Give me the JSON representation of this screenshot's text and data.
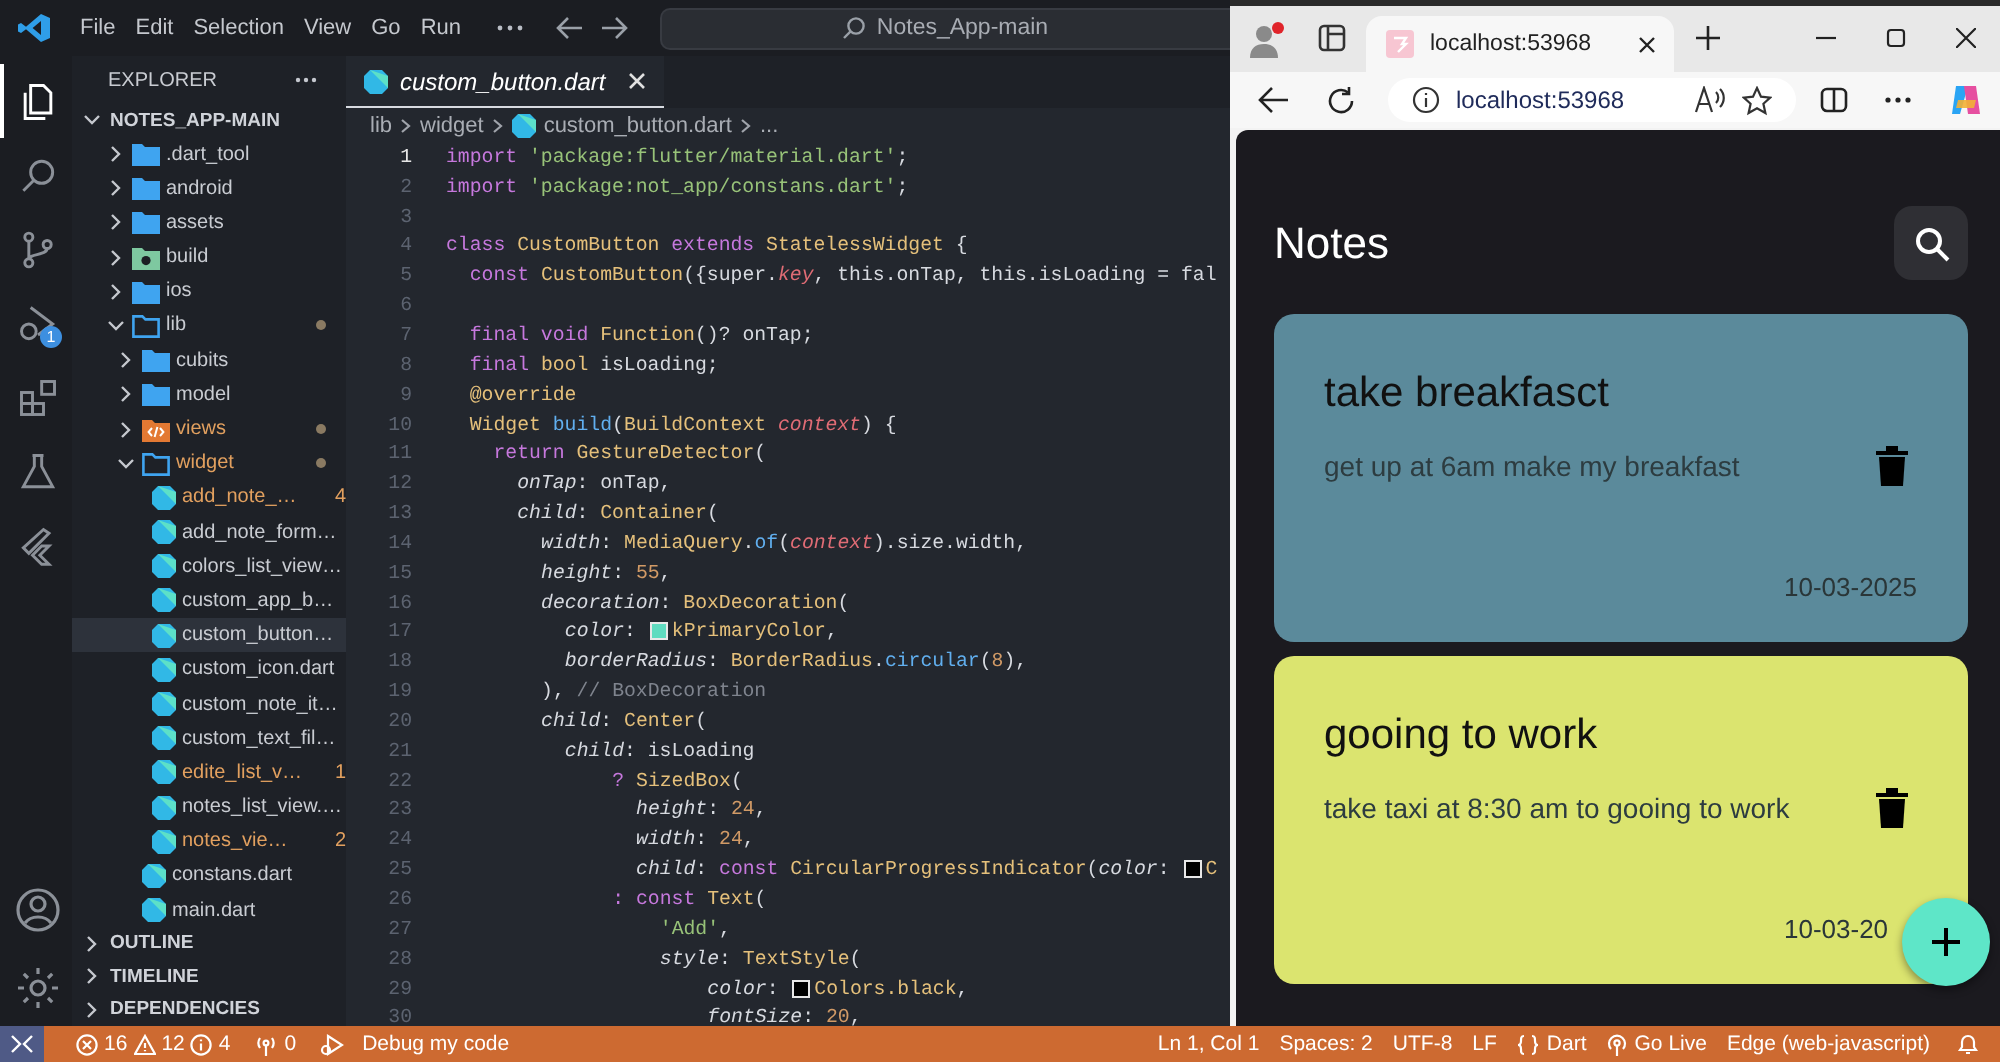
{
  "title_bar": {
    "menu": [
      "File",
      "Edit",
      "Selection",
      "View",
      "Go",
      "Run"
    ],
    "command_center": "Notes_App-main"
  },
  "activity_bar": {
    "items": [
      {
        "kind": "files",
        "selected": true
      },
      {
        "kind": "search",
        "selected": false
      },
      {
        "kind": "source-control",
        "selected": false
      },
      {
        "kind": "debug",
        "selected": false,
        "badge": "1"
      },
      {
        "kind": "extensions",
        "selected": false
      },
      {
        "kind": "testing",
        "selected": false
      },
      {
        "kind": "flutter",
        "selected": false
      }
    ],
    "bottom_items": [
      {
        "kind": "account"
      },
      {
        "kind": "settings"
      }
    ]
  },
  "explorer": {
    "title": "EXPLORER",
    "sections": [
      {
        "label": "NOTES_APP-MAIN",
        "expanded": true,
        "children": [
          {
            "label": ".dart_tool",
            "kind": "folder",
            "expanded": false,
            "selected": false,
            "warning": false,
            "dot": false
          },
          {
            "label": "android",
            "kind": "folder",
            "expanded": false,
            "selected": false,
            "warning": false,
            "dot": false
          },
          {
            "label": "assets",
            "kind": "folder",
            "expanded": false,
            "selected": false,
            "warning": false,
            "dot": false
          },
          {
            "label": "build",
            "kind": "build-folder",
            "expanded": false,
            "selected": false,
            "warning": false,
            "dot": false
          },
          {
            "label": "ios",
            "kind": "folder",
            "expanded": false,
            "selected": false,
            "warning": false,
            "dot": false
          },
          {
            "label": "lib",
            "kind": "folder",
            "expanded": true,
            "selected": false,
            "warning": false,
            "dot": true,
            "children": [
              {
                "label": "cubits",
                "kind": "folder",
                "expanded": false,
                "selected": false,
                "warning": false,
                "dot": false
              },
              {
                "label": "model",
                "kind": "folder",
                "expanded": false,
                "selected": false,
                "warning": false,
                "dot": false
              },
              {
                "label": "views",
                "kind": "views-folder",
                "expanded": false,
                "selected": false,
                "warning": true,
                "dot": true
              },
              {
                "label": "widget",
                "kind": "folder",
                "expanded": true,
                "selected": false,
                "warning": true,
                "dot": true,
                "children": [
                  {
                    "label": "add_note_…",
                    "kind": "dart",
                    "selected": false,
                    "warning": true,
                    "dot": false,
                    "badge": "4"
                  },
                  {
                    "label": "add_note_form…",
                    "kind": "dart",
                    "selected": false,
                    "warning": false,
                    "dot": false
                  },
                  {
                    "label": "colors_list_view…",
                    "kind": "dart",
                    "selected": false,
                    "warning": false,
                    "dot": false
                  },
                  {
                    "label": "custom_app_b…",
                    "kind": "dart",
                    "selected": false,
                    "warning": false,
                    "dot": false
                  },
                  {
                    "label": "custom_button…",
                    "kind": "dart",
                    "selected": true,
                    "warning": false,
                    "dot": false
                  },
                  {
                    "label": "custom_icon.dart",
                    "kind": "dart",
                    "selected": false,
                    "warning": false,
                    "dot": false
                  },
                  {
                    "label": "custom_note_it…",
                    "kind": "dart",
                    "selected": false,
                    "warning": false,
                    "dot": false
                  },
                  {
                    "label": "custom_text_fil…",
                    "kind": "dart",
                    "selected": false,
                    "warning": false,
                    "dot": false
                  },
                  {
                    "label": "edite_list_v…",
                    "kind": "dart",
                    "selected": false,
                    "warning": true,
                    "dot": false,
                    "badge": "1"
                  },
                  {
                    "label": "notes_list_view.…",
                    "kind": "dart",
                    "selected": false,
                    "warning": false,
                    "dot": false
                  },
                  {
                    "label": "notes_vie…",
                    "kind": "dart",
                    "selected": false,
                    "warning": true,
                    "dot": false,
                    "badge": "2"
                  }
                ]
              },
              {
                "label": "constans.dart",
                "kind": "dart",
                "selected": false,
                "warning": false,
                "dot": false
              },
              {
                "label": "main.dart",
                "kind": "dart",
                "selected": false,
                "warning": false,
                "dot": false
              }
            ]
          }
        ]
      },
      {
        "label": "OUTLINE",
        "expanded": false
      },
      {
        "label": "TIMELINE",
        "expanded": false
      },
      {
        "label": "DEPENDENCIES",
        "expanded": false
      }
    ]
  },
  "editor": {
    "tab": {
      "title": "custom_button.dart"
    },
    "breadcrumb": [
      {
        "kind": "folder",
        "text": "lib"
      },
      {
        "kind": "folder",
        "text": "widget"
      },
      {
        "kind": "file",
        "text": "custom_button.dart"
      },
      {
        "kind": "symbol",
        "text": "..."
      }
    ],
    "lines": [
      {
        "number": "1",
        "current": true,
        "tokens": [
          {
            "kind": "kw",
            "text": "import "
          },
          {
            "kind": "str",
            "text": "'package:flutter/material.dart'"
          },
          {
            "kind": "plain",
            "text": ";"
          }
        ]
      },
      {
        "number": "2",
        "current": false,
        "tokens": [
          {
            "kind": "kw",
            "text": "import "
          },
          {
            "kind": "str",
            "text": "'package:not_app/constans.dart'"
          },
          {
            "kind": "plain",
            "text": ";"
          }
        ]
      },
      {
        "number": "3",
        "current": false
      },
      {
        "number": "4",
        "current": false,
        "tokens": [
          {
            "kind": "kw",
            "text": "class "
          },
          {
            "kind": "type",
            "text": "CustomButton "
          },
          {
            "kind": "kw",
            "text": "extends "
          },
          {
            "kind": "type",
            "text": "StatelessWidget"
          },
          {
            "kind": "plain",
            "text": " {"
          }
        ]
      },
      {
        "number": "5",
        "current": false,
        "tokens": [
          {
            "kind": "kw",
            "text": "  const "
          },
          {
            "kind": "type",
            "text": "CustomButton"
          },
          {
            "kind": "plain",
            "text": "({super."
          },
          {
            "kind": "var",
            "text": "key"
          },
          {
            "kind": "plain",
            "text": ", this.onTap, this.isLoading = fal"
          }
        ]
      },
      {
        "number": "6",
        "current": false
      },
      {
        "number": "7",
        "current": false,
        "tokens": [
          {
            "kind": "kw",
            "text": "  final void "
          },
          {
            "kind": "type",
            "text": "Function"
          },
          {
            "kind": "plain",
            "text": "()? onTap;"
          }
        ]
      },
      {
        "number": "8",
        "current": false,
        "tokens": [
          {
            "kind": "kw",
            "text": "  final "
          },
          {
            "kind": "type",
            "text": "bool"
          },
          {
            "kind": "plain",
            "text": " isLoading;"
          }
        ]
      },
      {
        "number": "9",
        "current": false,
        "tokens": [
          {
            "kind": "type",
            "text": "  @override"
          }
        ]
      },
      {
        "number": "10",
        "current": false,
        "tokens": [
          {
            "kind": "type",
            "text": "  Widget "
          },
          {
            "kind": "fn",
            "text": "build"
          },
          {
            "kind": "plain",
            "text": "("
          },
          {
            "kind": "type",
            "text": "BuildContext "
          },
          {
            "kind": "var",
            "text": "context"
          },
          {
            "kind": "plain",
            "text": ") {"
          }
        ]
      },
      {
        "number": "11",
        "current": false,
        "tokens": [
          {
            "kind": "kw",
            "text": "    return "
          },
          {
            "kind": "type",
            "text": "GestureDetector"
          },
          {
            "kind": "plain",
            "text": "("
          }
        ]
      },
      {
        "number": "12",
        "current": false,
        "tokens": [
          {
            "kind": "prop",
            "text": "      onTap"
          },
          {
            "kind": "plain",
            "text": ": onTap,"
          }
        ]
      },
      {
        "number": "13",
        "current": false,
        "tokens": [
          {
            "kind": "prop",
            "text": "      child"
          },
          {
            "kind": "plain",
            "text": ": "
          },
          {
            "kind": "type",
            "text": "Container"
          },
          {
            "kind": "plain",
            "text": "("
          }
        ]
      },
      {
        "number": "14",
        "current": false,
        "tokens": [
          {
            "kind": "prop",
            "text": "        width"
          },
          {
            "kind": "plain",
            "text": ": "
          },
          {
            "kind": "type",
            "text": "MediaQuery"
          },
          {
            "kind": "plain",
            "text": "."
          },
          {
            "kind": "fn",
            "text": "of"
          },
          {
            "kind": "plain",
            "text": "("
          },
          {
            "kind": "var",
            "text": "context"
          },
          {
            "kind": "plain",
            "text": ").size.width,"
          }
        ]
      },
      {
        "number": "15",
        "current": false,
        "tokens": [
          {
            "kind": "prop",
            "text": "        height"
          },
          {
            "kind": "plain",
            "text": ": "
          },
          {
            "kind": "num",
            "text": "55"
          },
          {
            "kind": "plain",
            "text": ","
          }
        ]
      },
      {
        "number": "16",
        "current": false,
        "tokens": [
          {
            "kind": "prop",
            "text": "        decoration"
          },
          {
            "kind": "plain",
            "text": ": "
          },
          {
            "kind": "type",
            "text": "BoxDecoration"
          },
          {
            "kind": "plain",
            "text": "("
          }
        ]
      },
      {
        "number": "17",
        "current": false,
        "tokens": [
          {
            "kind": "prop",
            "text": "          color"
          },
          {
            "kind": "plain",
            "text": ": "
          },
          {
            "kind": "swatch",
            "color": "#5fdcc0"
          },
          {
            "kind": "type",
            "text": "kPrimaryColor"
          },
          {
            "kind": "plain",
            "text": ","
          }
        ]
      },
      {
        "number": "18",
        "current": false,
        "tokens": [
          {
            "kind": "prop",
            "text": "          borderRadius"
          },
          {
            "kind": "plain",
            "text": ": "
          },
          {
            "kind": "type",
            "text": "BorderRadius"
          },
          {
            "kind": "plain",
            "text": "."
          },
          {
            "kind": "fn",
            "text": "circular"
          },
          {
            "kind": "plain",
            "text": "("
          },
          {
            "kind": "num",
            "text": "8"
          },
          {
            "kind": "plain",
            "text": "),"
          }
        ]
      },
      {
        "number": "19",
        "current": false,
        "tokens": [
          {
            "kind": "plain",
            "text": "        ), "
          },
          {
            "kind": "comment",
            "text": "// BoxDecoration"
          }
        ]
      },
      {
        "number": "20",
        "current": false,
        "tokens": [
          {
            "kind": "prop",
            "text": "        child"
          },
          {
            "kind": "plain",
            "text": ": "
          },
          {
            "kind": "type",
            "text": "Center"
          },
          {
            "kind": "plain",
            "text": "("
          }
        ]
      },
      {
        "number": "21",
        "current": false,
        "tokens": [
          {
            "kind": "prop",
            "text": "          child"
          },
          {
            "kind": "plain",
            "text": ": isLoading"
          }
        ]
      },
      {
        "number": "22",
        "current": false,
        "tokens": [
          {
            "kind": "kw",
            "text": "              ? "
          },
          {
            "kind": "type",
            "text": "SizedBox"
          },
          {
            "kind": "plain",
            "text": "("
          }
        ]
      },
      {
        "number": "23",
        "current": false,
        "tokens": [
          {
            "kind": "prop",
            "text": "                height"
          },
          {
            "kind": "plain",
            "text": ": "
          },
          {
            "kind": "num",
            "text": "24"
          },
          {
            "kind": "plain",
            "text": ","
          }
        ]
      },
      {
        "number": "24",
        "current": false,
        "tokens": [
          {
            "kind": "prop",
            "text": "                width"
          },
          {
            "kind": "plain",
            "text": ": "
          },
          {
            "kind": "num",
            "text": "24"
          },
          {
            "kind": "plain",
            "text": ","
          }
        ]
      },
      {
        "number": "25",
        "current": false,
        "tokens": [
          {
            "kind": "prop",
            "text": "                child"
          },
          {
            "kind": "plain",
            "text": ": "
          },
          {
            "kind": "kw",
            "text": "const "
          },
          {
            "kind": "type",
            "text": "CircularProgressIndicator"
          },
          {
            "kind": "plain",
            "text": "("
          },
          {
            "kind": "prop",
            "text": "color"
          },
          {
            "kind": "plain",
            "text": ": "
          },
          {
            "kind": "swatch",
            "color": "#000000"
          },
          {
            "kind": "type",
            "text": "C"
          }
        ]
      },
      {
        "number": "26",
        "current": false,
        "tokens": [
          {
            "kind": "kw",
            "text": "              : const "
          },
          {
            "kind": "type",
            "text": "Text"
          },
          {
            "kind": "plain",
            "text": "("
          }
        ]
      },
      {
        "number": "27",
        "current": false,
        "tokens": [
          {
            "kind": "str",
            "text": "                  'Add'"
          },
          {
            "kind": "plain",
            "text": ","
          }
        ]
      },
      {
        "number": "28",
        "current": false,
        "tokens": [
          {
            "kind": "prop",
            "text": "                  style"
          },
          {
            "kind": "plain",
            "text": ": "
          },
          {
            "kind": "type",
            "text": "TextStyle"
          },
          {
            "kind": "plain",
            "text": "("
          }
        ]
      },
      {
        "number": "29",
        "current": false,
        "tokens": [
          {
            "kind": "prop",
            "text": "                      color"
          },
          {
            "kind": "plain",
            "text": ": "
          },
          {
            "kind": "swatch",
            "color": "#000000"
          },
          {
            "kind": "type",
            "text": "Colors.black"
          },
          {
            "kind": "plain",
            "text": ","
          }
        ]
      },
      {
        "number": "30",
        "current": false,
        "tokens": [
          {
            "kind": "prop",
            "text": "                      fontSize"
          },
          {
            "kind": "plain",
            "text": ": "
          },
          {
            "kind": "num",
            "text": "20"
          },
          {
            "kind": "plain",
            "text": ","
          }
        ]
      }
    ]
  },
  "browser": {
    "tab": {
      "title": "localhost:53968"
    },
    "address": "localhost:53968",
    "app": {
      "title": "Notes",
      "notes": [
        {
          "title": "take breakfasct",
          "body": "get up at 6am make my breakfast",
          "date": "10-03-2025",
          "color": "#5b8a9b"
        },
        {
          "title": "gooing to work",
          "body": "take taxi at 8:30 am to gooing to work",
          "date": "10-03-20",
          "color": "#dbe46f"
        }
      ]
    }
  },
  "status_bar": {
    "errors": "16",
    "warnings": "12",
    "infos": "4",
    "ports": "0",
    "debug": "Debug my code",
    "items": [
      {
        "kind": "text",
        "text": "Ln 1, Col 1"
      },
      {
        "kind": "text",
        "text": "Spaces: 2"
      },
      {
        "kind": "text",
        "text": "UTF-8"
      },
      {
        "kind": "text",
        "text": "LF"
      },
      {
        "kind": "language",
        "text": "Dart"
      },
      {
        "kind": "live",
        "text": "Go Live"
      },
      {
        "kind": "text",
        "text": "Edge (web-javascript)"
      }
    ]
  }
}
